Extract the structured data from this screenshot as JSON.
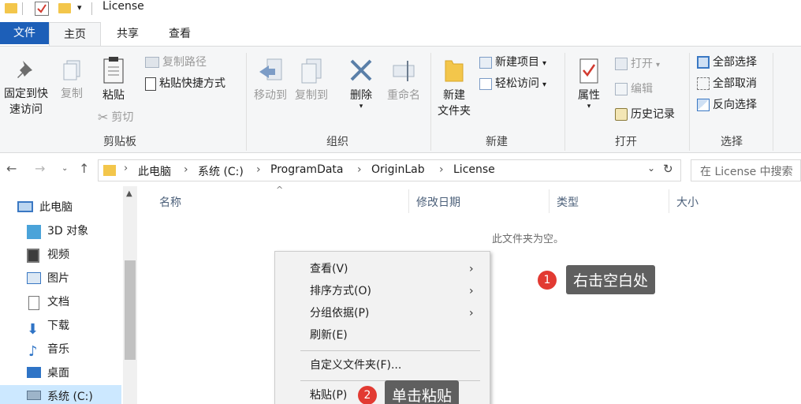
{
  "window": {
    "title": "License"
  },
  "tabs": {
    "file": "文件",
    "home": "主页",
    "share": "共享",
    "view": "查看"
  },
  "ribbon": {
    "clipboard": {
      "pin_line1": "固定到快",
      "pin_line2": "速访问",
      "copy": "复制",
      "paste": "粘贴",
      "copy_path": "复制路径",
      "paste_shortcut": "粘贴快捷方式",
      "cut": "剪切",
      "label": "剪贴板"
    },
    "organize": {
      "move_to": "移动到",
      "copy_to": "复制到",
      "delete": "删除",
      "rename": "重命名",
      "label": "组织"
    },
    "new": {
      "new_folder_line1": "新建",
      "new_folder_line2": "文件夹",
      "new_item": "新建项目",
      "easy_access": "轻松访问",
      "label": "新建"
    },
    "open": {
      "properties": "属性",
      "open": "打开",
      "edit": "编辑",
      "history": "历史记录",
      "label": "打开"
    },
    "select": {
      "select_all": "全部选择",
      "select_none": "全部取消",
      "invert": "反向选择",
      "label": "选择"
    }
  },
  "address": {
    "crumbs": [
      "此电脑",
      "系统 (C:)",
      "ProgramData",
      "OriginLab",
      "License"
    ],
    "search_placeholder": "在 License 中搜索"
  },
  "navpane": {
    "items": [
      "此电脑",
      "3D 对象",
      "视频",
      "图片",
      "文档",
      "下载",
      "音乐",
      "桌面",
      "系统 (C:)"
    ]
  },
  "columns": {
    "name": "名称",
    "modified": "修改日期",
    "type": "类型",
    "size": "大小"
  },
  "empty_message": "此文件夹为空。",
  "context_menu": {
    "items": [
      "查看(V)",
      "排序方式(O)",
      "分组依据(P)",
      "刷新(E)",
      "自定义文件夹(F)...",
      "粘贴(P)"
    ]
  },
  "callouts": [
    {
      "number": "1",
      "text": "右击空白处"
    },
    {
      "number": "2",
      "text": "单击粘贴"
    }
  ],
  "colors": {
    "accent": "#1d5fb8",
    "badge": "#e23a32",
    "callout_bg": "#5f5f5f",
    "folder": "#f3c64b"
  }
}
